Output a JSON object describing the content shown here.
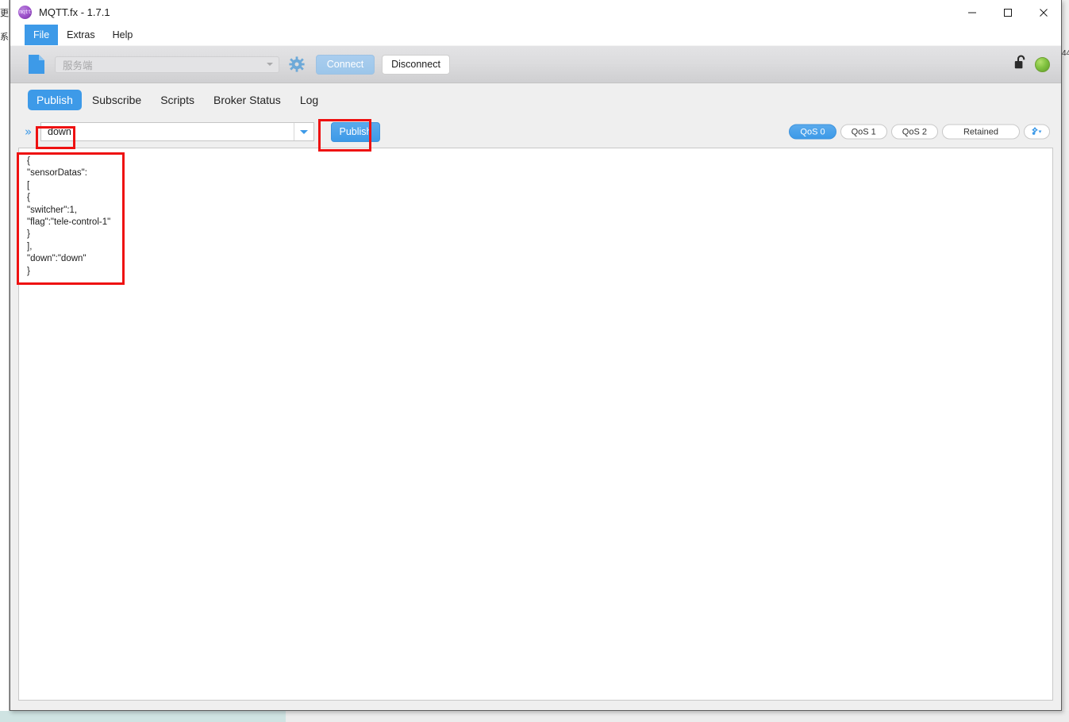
{
  "window": {
    "title": "MQTT.fx - 1.7.1",
    "app_icon": "mqtt-logo-icon",
    "controls": {
      "minimize": "minimize-icon",
      "maximize": "maximize-icon",
      "close": "close-icon"
    }
  },
  "menubar": {
    "items": [
      {
        "label": "File",
        "active": true
      },
      {
        "label": "Extras",
        "active": false
      },
      {
        "label": "Help",
        "active": false
      }
    ]
  },
  "connection_toolbar": {
    "doc_icon": "new-document-icon",
    "broker_profile": {
      "value": "",
      "placeholder": "服务端"
    },
    "gear_icon": "settings-gear-icon",
    "connect_label": "Connect",
    "connect_enabled": false,
    "disconnect_label": "Disconnect",
    "disconnect_enabled": true,
    "lock_icon": "unlocked-padlock-icon",
    "status_indicator": "connected-green-dot",
    "status_color": "#82c341"
  },
  "tabs": [
    {
      "label": "Publish",
      "active": true
    },
    {
      "label": "Subscribe",
      "active": false
    },
    {
      "label": "Scripts",
      "active": false
    },
    {
      "label": "Broker Status",
      "active": false
    },
    {
      "label": "Log",
      "active": false
    }
  ],
  "publish_bar": {
    "expand_icon": "double-chevron-right-icon",
    "topic": {
      "value": "down",
      "placeholder": ""
    },
    "dropdown_icon": "chevron-down-icon",
    "publish_label": "Publish",
    "qos_options": [
      {
        "label": "QoS 0",
        "selected": true
      },
      {
        "label": "QoS 1",
        "selected": false
      },
      {
        "label": "QoS 2",
        "selected": false
      }
    ],
    "retained_label": "Retained",
    "retained_selected": false,
    "options_icon": "publish-options-gear-icon"
  },
  "payload": {
    "text": "{\n\"sensorDatas\":\n[\n{\n\"switcher\":1,\n\"flag\":\"tele-control-1\"\n}\n],\n\"down\":\"down\"\n}"
  },
  "annotations": {
    "color": "#ee1111",
    "boxes": [
      {
        "name": "topic-highlight",
        "target": "topic-input"
      },
      {
        "name": "publish-button-highlight",
        "target": "publish-button"
      },
      {
        "name": "payload-highlight",
        "target": "payload-editor"
      }
    ]
  },
  "background": {
    "left_strip_glyphs": [
      "更",
      "系"
    ],
    "right_panel_text": "44",
    "desktop_color": "#cfe3e2"
  }
}
